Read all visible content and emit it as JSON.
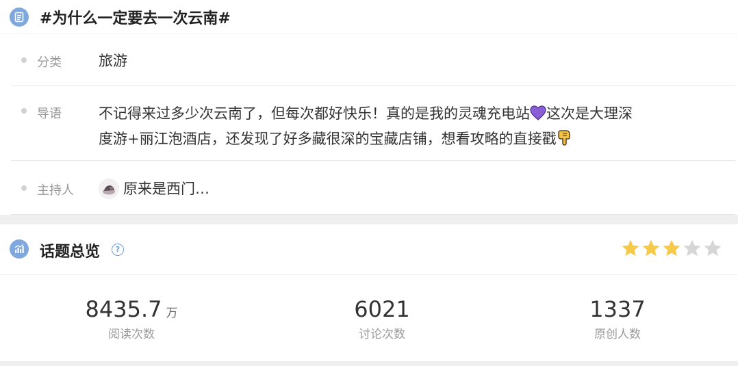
{
  "topic": {
    "title": "#为什么一定要去一次云南#"
  },
  "info": {
    "category_label": "分类",
    "category_value": "旅游",
    "guide_label": "导语",
    "guide_line1_a": "不记得来过多少次云南了，但每次都好快乐！真的是我的灵魂充电站",
    "guide_line1_b": "这次是大理深",
    "guide_line2": "度游+丽江泡酒店，还发现了好多藏很深的宝藏店铺，想看攻略的直接戳",
    "host_label": "主持人",
    "host_name": "原来是西门…"
  },
  "overview": {
    "title": "话题总览",
    "help_icon": "question-circle-icon",
    "rating": 3,
    "rating_max": 5,
    "star_color": "#f7c948",
    "star_empty_color": "#d6d6d6",
    "stats": {
      "read_value": "8435.7",
      "read_unit": "万",
      "read_label": "阅读次数",
      "discuss_value": "6021",
      "discuss_label": "讨论次数",
      "original_value": "1337",
      "original_label": "原创人数"
    }
  },
  "colors": {
    "accent_icon": "#7fa8de",
    "heart": "#8a5fd6",
    "hand": "#f2c043"
  }
}
